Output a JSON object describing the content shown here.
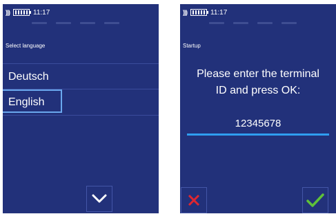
{
  "left_screen": {
    "status": {
      "time": "11:17"
    },
    "section_label": "Select language",
    "languages": [
      {
        "label": "Deutsch"
      },
      {
        "label": "English"
      }
    ],
    "selected_language": "English",
    "scroll_down_icon": "chevron-down-icon"
  },
  "right_screen": {
    "status": {
      "time": "11:17"
    },
    "section_label": "Startup",
    "prompt_line1": "Please enter the terminal",
    "prompt_line2": "ID and press OK:",
    "terminal_id_value": "12345678",
    "cancel_icon": "x-icon",
    "ok_icon": "checkmark-icon"
  },
  "colors": {
    "screen_background": "#22317a",
    "selection_border": "#6aa8ee",
    "input_underline": "#2f9ef0",
    "cancel": "#e0262f",
    "ok": "#5fc13a"
  }
}
